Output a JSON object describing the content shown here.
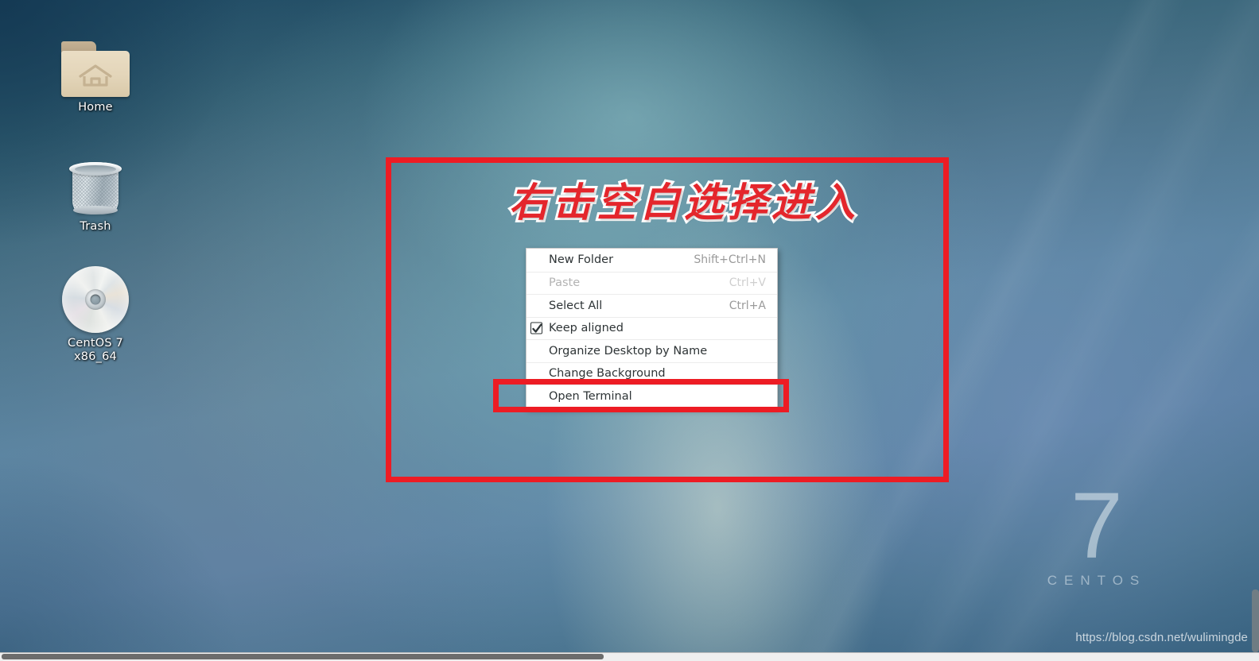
{
  "desktop": {
    "icons": [
      {
        "name": "Home",
        "icon": "folder-home-icon"
      },
      {
        "name": "Trash",
        "icon": "trash-can-icon"
      },
      {
        "name": "CentOS 7 x86_64",
        "icon": "optical-disc-icon"
      }
    ],
    "watermark": {
      "version_number": "7",
      "distro_name": "CENTOS"
    },
    "blog_watermark": "https://blog.csdn.net/wulimingde"
  },
  "context_menu": {
    "items": [
      {
        "label": "New Folder",
        "accel": "Shift+Ctrl+N",
        "disabled": false,
        "checkbox": false
      },
      {
        "label": "Paste",
        "accel": "Ctrl+V",
        "disabled": true,
        "checkbox": false
      },
      {
        "label": "Select All",
        "accel": "Ctrl+A",
        "disabled": false,
        "checkbox": false
      },
      {
        "label": "Keep aligned",
        "accel": "",
        "disabled": false,
        "checkbox": true,
        "checked": true
      },
      {
        "label": "Organize Desktop by Name",
        "accel": "",
        "disabled": false,
        "checkbox": false
      },
      {
        "label": "Change Background",
        "accel": "",
        "disabled": false,
        "checkbox": false
      },
      {
        "label": "Open Terminal",
        "accel": "",
        "disabled": false,
        "checkbox": false
      }
    ]
  },
  "annotations": {
    "instruction_text": "右击空白选择进入",
    "highlight_color": "#ed1c24",
    "text_color": "#e4262c",
    "text_outline_color": "#ffffff"
  }
}
